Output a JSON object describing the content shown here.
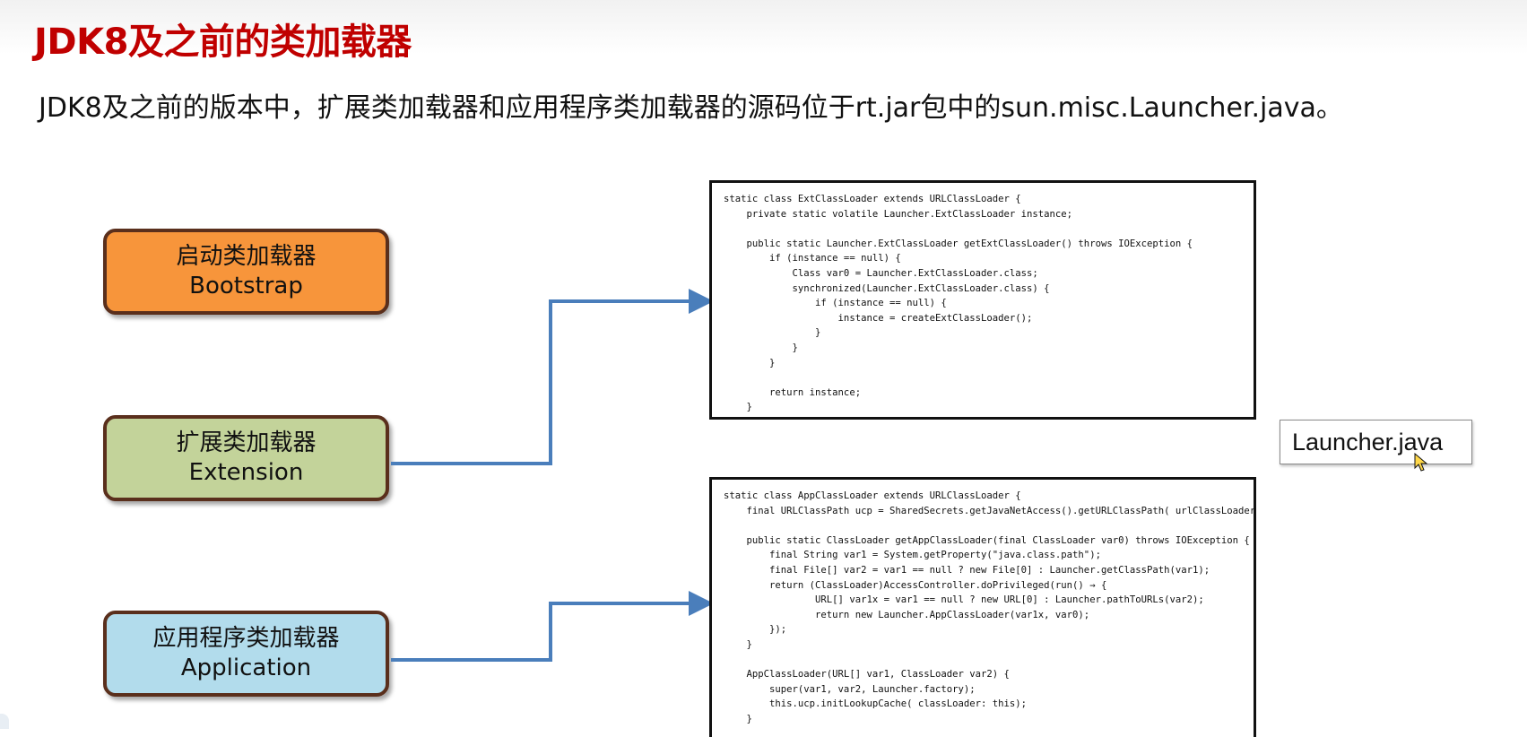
{
  "title": "JDK8及之前的类加载器",
  "subtitle": "JDK8及之前的版本中，扩展类加载器和应用程序类加载器的源码位于rt.jar包中的sun.misc.Launcher.java。",
  "loaders": {
    "bootstrap": {
      "cn": "启动类加载器",
      "en": "Bootstrap",
      "color": "#f7953b"
    },
    "extension": {
      "cn": "扩展类加载器",
      "en": "Extension",
      "color": "#c3d39a"
    },
    "application": {
      "cn": "应用程序类加载器",
      "en": "Application",
      "color": "#b2dcec"
    }
  },
  "arrow_color": "#4a7ebb",
  "file_label": "Launcher.java",
  "ext_code": [
    "static class ExtClassLoader extends URLClassLoader {",
    "    private static volatile Launcher.ExtClassLoader instance;",
    "",
    "    public static Launcher.ExtClassLoader getExtClassLoader() throws IOException {",
    "        if (instance == null) {",
    "            Class var0 = Launcher.ExtClassLoader.class;",
    "            synchronized(Launcher.ExtClassLoader.class) {",
    "                if (instance == null) {",
    "                    instance = createExtClassLoader();",
    "                }",
    "            }",
    "        }",
    "",
    "        return instance;",
    "    }"
  ],
  "app_code": [
    "static class AppClassLoader extends URLClassLoader {",
    "    final URLClassPath ucp = SharedSecrets.getJavaNetAccess().getURLClassPath( urlClassLoader: this);",
    "",
    "    public static ClassLoader getAppClassLoader(final ClassLoader var0) throws IOException {",
    "        final String var1 = System.getProperty(\"java.class.path\");",
    "        final File[] var2 = var1 == null ? new File[0] : Launcher.getClassPath(var1);",
    "        return (ClassLoader)AccessController.doPrivileged(run() → {",
    "                URL[] var1x = var1 == null ? new URL[0] : Launcher.pathToURLs(var2);",
    "                return new Launcher.AppClassLoader(var1x, var0);",
    "        });",
    "    }",
    "",
    "    AppClassLoader(URL[] var1, ClassLoader var2) {",
    "        super(var1, var2, Launcher.factory);",
    "        this.ucp.initLookupCache( classLoader: this);",
    "    }"
  ]
}
